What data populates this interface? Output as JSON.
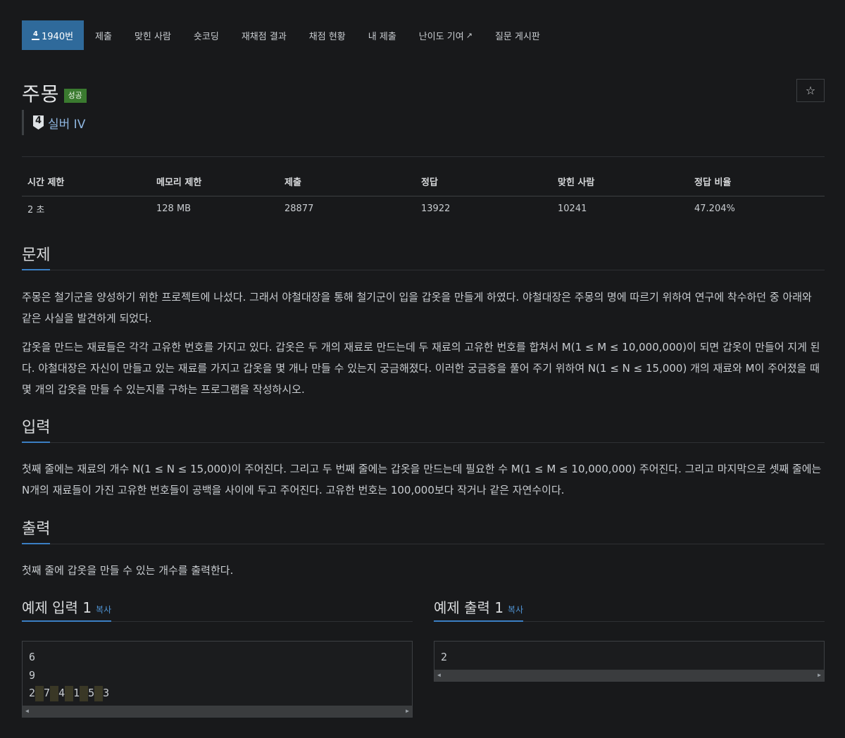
{
  "nav": {
    "active_tier_digit": "4",
    "problem_number_label": "1940번",
    "items": [
      "제출",
      "맞힌 사람",
      "숏코딩",
      "재채점 결과",
      "채점 현황",
      "내 제출",
      "난이도 기여",
      "질문 게시판"
    ]
  },
  "problem": {
    "title": "주몽",
    "status_badge": "성공",
    "tier_digit": "4",
    "tier_label": "실버 IV",
    "star_icon": "☆"
  },
  "stats": {
    "headers": [
      "시간 제한",
      "메모리 제한",
      "제출",
      "정답",
      "맞힌 사람",
      "정답 비율"
    ],
    "values": [
      "2 초",
      "128 MB",
      "28877",
      "13922",
      "10241",
      "47.204%"
    ]
  },
  "sections": {
    "problem_title": "문제",
    "problem_paragraphs": [
      "주몽은 철기군을 양성하기 위한 프로젝트에 나섰다. 그래서 야철대장을 통해 철기군이 입을 갑옷을 만들게 하였다. 야철대장은 주몽의 명에 따르기 위하여 연구에 착수하던 중 아래와 같은 사실을 발견하게 되었다.",
      "갑옷을 만드는 재료들은 각각 고유한 번호를 가지고 있다. 갑옷은 두 개의 재료로 만드는데 두 재료의 고유한 번호를 합쳐서 M(1 ≤ M ≤ 10,000,000)이 되면 갑옷이 만들어 지게 된다. 야철대장은 자신이 만들고 있는 재료를 가지고 갑옷을 몇 개나 만들 수 있는지 궁금해졌다. 이러한 궁금증을 풀어 주기 위하여 N(1 ≤ N ≤ 15,000) 개의 재료와 M이 주어졌을 때 몇 개의 갑옷을 만들 수 있는지를 구하는 프로그램을 작성하시오."
    ],
    "input_title": "입력",
    "input_text": "첫째 줄에는 재료의 개수 N(1 ≤ N ≤ 15,000)이 주어진다. 그리고 두 번째 줄에는 갑옷을 만드는데 필요한 수 M(1 ≤ M ≤ 10,000,000) 주어진다. 그리고 마지막으로 셋째 줄에는 N개의 재료들이 가진 고유한 번호들이 공백을 사이에 두고 주어진다. 고유한 번호는 100,000보다 작거나 같은 자연수이다.",
    "output_title": "출력",
    "output_text": "첫째 줄에 갑옷을 만들 수 있는 개수를 출력한다."
  },
  "samples": {
    "input_title": "예제 입력 1",
    "output_title": "예제 출력 1",
    "copy_label": "복사",
    "input_lines": [
      "6",
      "9"
    ],
    "input_tokens": [
      "2",
      "7",
      "4",
      "1",
      "5",
      "3"
    ],
    "output_lines": [
      "2"
    ]
  },
  "colors": {
    "background": "#18191b",
    "active_tab": "#2f6a9b",
    "success_badge": "#3a7a2f",
    "accent_underline": "#3b7fc4",
    "tier_link": "#8fb6e0"
  }
}
